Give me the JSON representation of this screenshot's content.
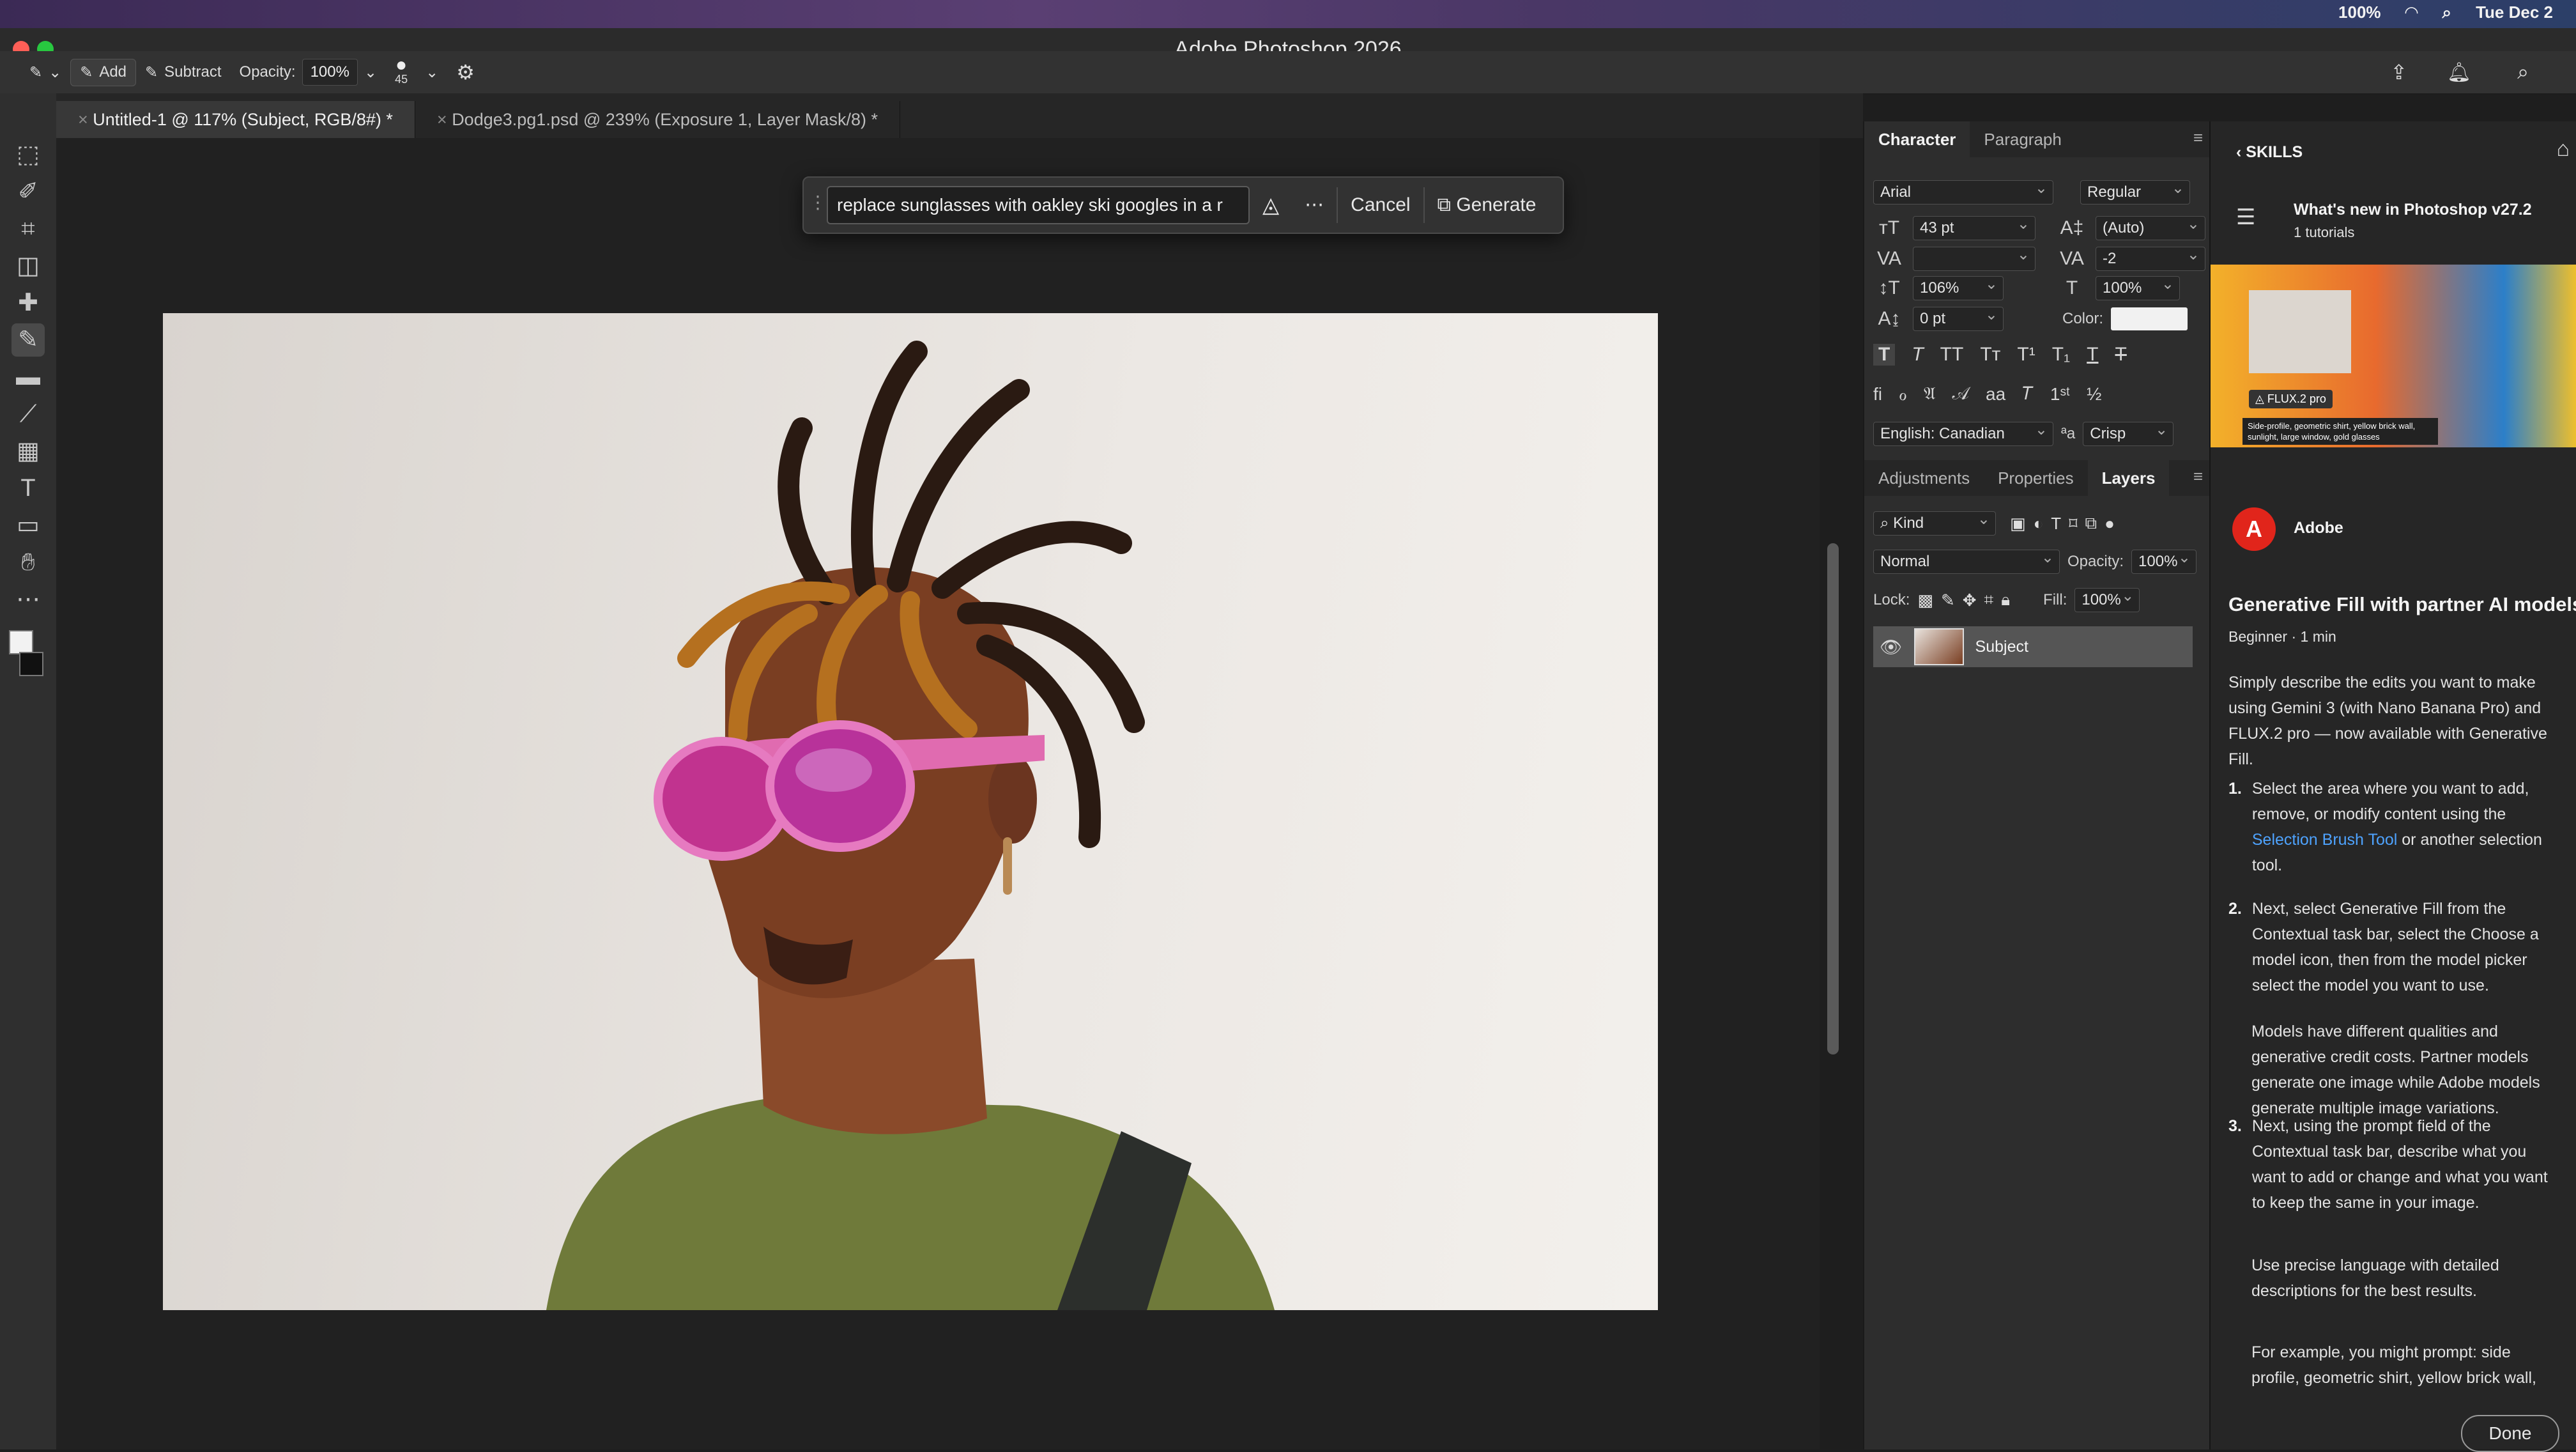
{
  "menubar": {
    "battery": "100%",
    "clock": "Tue Dec 2"
  },
  "app": {
    "title": "Adobe Photoshop 2026"
  },
  "options": {
    "add_label": "Add",
    "subtract_label": "Subtract",
    "opacity_label": "Opacity:",
    "opacity_value": "100%",
    "brush_size": "45"
  },
  "tabs": [
    {
      "label": "Untitled-1 @ 117% (Subject, RGB/8#) *"
    },
    {
      "label": "Dodge3.pg1.psd @ 239% (Exposure 1, Layer Mask/8) *"
    }
  ],
  "taskbar": {
    "prompt_value": "replace sunglasses with oakley ski googles in a r",
    "cancel_label": "Cancel",
    "generate_label": "Generate"
  },
  "character": {
    "tab_character": "Character",
    "tab_paragraph": "Paragraph",
    "font_family": "Arial",
    "font_style": "Regular",
    "size": "43 pt",
    "leading": "(Auto)",
    "tracking": "-2",
    "vscale": "106%",
    "hscale": "100%",
    "baseline": "0 pt",
    "color_label": "Color:",
    "language": "English: Canadian",
    "aa_label": "ªa",
    "antialias": "Crisp"
  },
  "layers": {
    "tab_adjustments": "Adjustments",
    "tab_properties": "Properties",
    "tab_layers": "Layers",
    "filter": "Kind",
    "blend": "Normal",
    "opacity_label": "Opacity:",
    "opacity": "100%",
    "lock_label": "Lock:",
    "fill_label": "Fill:",
    "fill": "100%",
    "layer_name": "Subject"
  },
  "skills": {
    "header": "SKILLS",
    "whats_new": "What's new in Photoshop v27.2",
    "tutorials": "1 tutorials",
    "thumb_badge": "FLUX.2 pro",
    "thumb_caption": "Side-profile, geometric shirt, yellow brick wall, sunlight, large window, gold glasses",
    "author": "Adobe",
    "title": "Generative Fill with partner AI models",
    "meta": "Beginner · 1 min",
    "intro": "Simply describe the edits you want to make using Gemini 3 (with Nano Banana Pro) and FLUX.2 pro — now available with Generative Fill.",
    "step1_a": "Select the area where you want to add, remove, or modify content using the",
    "step1_link": "Selection Brush Tool",
    "step1_b": "or another selection tool.",
    "step2": "Next, select Generative Fill from the Contextual task bar, select the Choose a model icon, then from the model picker select the model you want to use.",
    "step2_note": "Models have different qualities and generative credit costs. Partner models generate one image while Adobe models generate multiple image variations.",
    "step3": "Next, using the prompt field of the Contextual task bar, describe what you want to add or change and what you want to keep the same in your image.",
    "step3_note": "Use precise language with detailed descriptions for the best results.",
    "example": "For example, you might prompt: side profile, geometric shirt, yellow brick wall,",
    "done_label": "Done"
  }
}
